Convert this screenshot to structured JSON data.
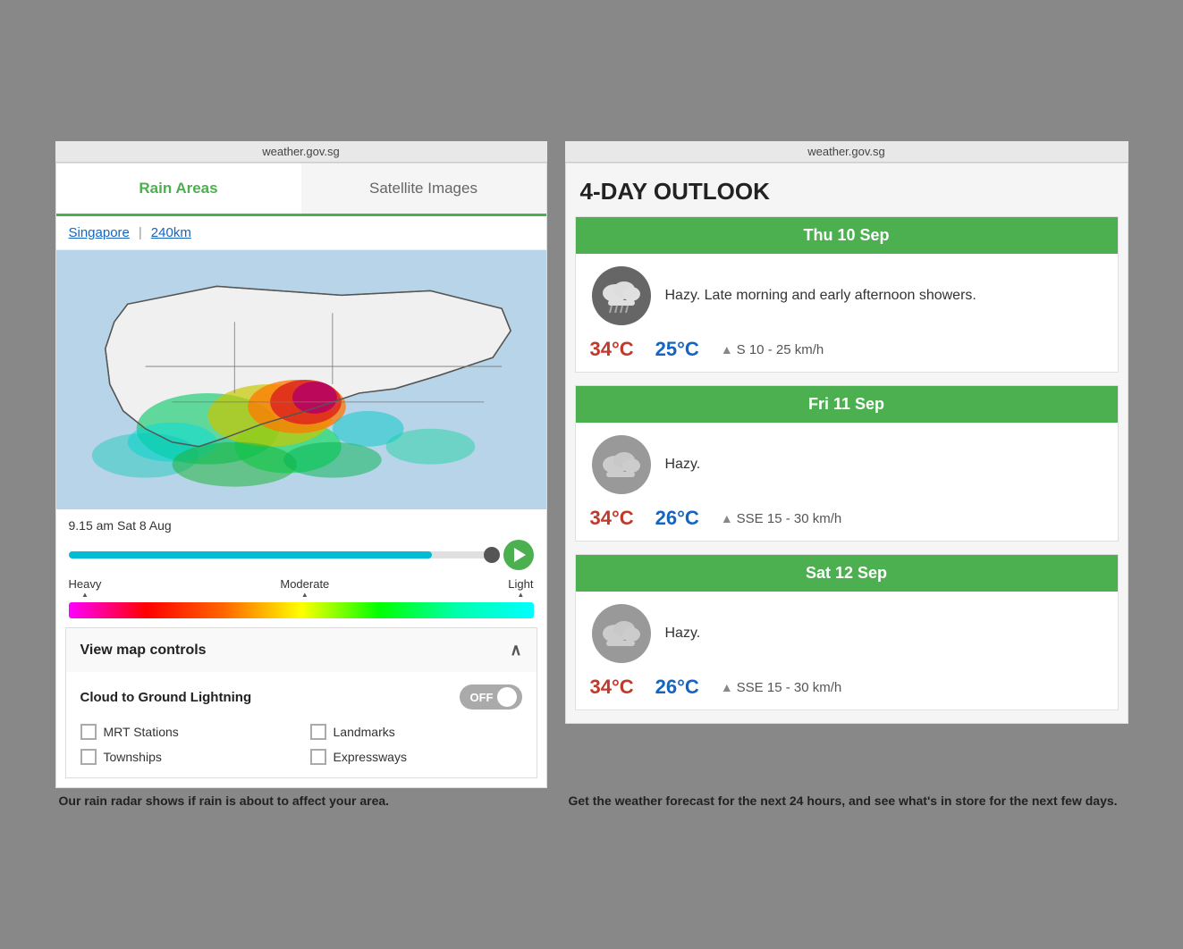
{
  "browser": {
    "url_left": "weather.gov.sg",
    "url_right": "weather.gov.sg"
  },
  "left_panel": {
    "tab_rain": "Rain Areas",
    "tab_satellite": "Satellite Images",
    "link_singapore": "Singapore",
    "separator": "|",
    "link_240km": "240km",
    "time_label": "9.15 am Sat 8 Aug",
    "legend_heavy": "Heavy",
    "legend_moderate": "Moderate",
    "legend_light": "Light",
    "map_controls_label": "View map controls",
    "lightning_label": "Cloud to Ground Lightning",
    "toggle_state": "OFF",
    "checkbox1": "MRT Stations",
    "checkbox2": "Landmarks",
    "checkbox3": "Townships",
    "checkbox4": "Expressways",
    "caption": "Our rain radar shows if rain is about to affect your area."
  },
  "right_panel": {
    "title": "4-DAY OUTLOOK",
    "days": [
      {
        "date": "Thu 10 Sep",
        "description": "Hazy. Late morning and early afternoon showers.",
        "temp_high": "34°C",
        "temp_low": "25°C",
        "wind": "S 10 - 25 km/h",
        "icon_type": "rain-cloud"
      },
      {
        "date": "Fri 11 Sep",
        "description": "Hazy.",
        "temp_high": "34°C",
        "temp_low": "26°C",
        "wind": "SSE 15 - 30 km/h",
        "icon_type": "hazy-cloud"
      },
      {
        "date": "Sat 12 Sep",
        "description": "Hazy.",
        "temp_high": "34°C",
        "temp_low": "26°C",
        "wind": "SSE 15 - 30 km/h",
        "icon_type": "hazy-cloud"
      }
    ],
    "caption": "Get the weather forecast for the next 24 hours, and see what's in store for the next few days."
  }
}
